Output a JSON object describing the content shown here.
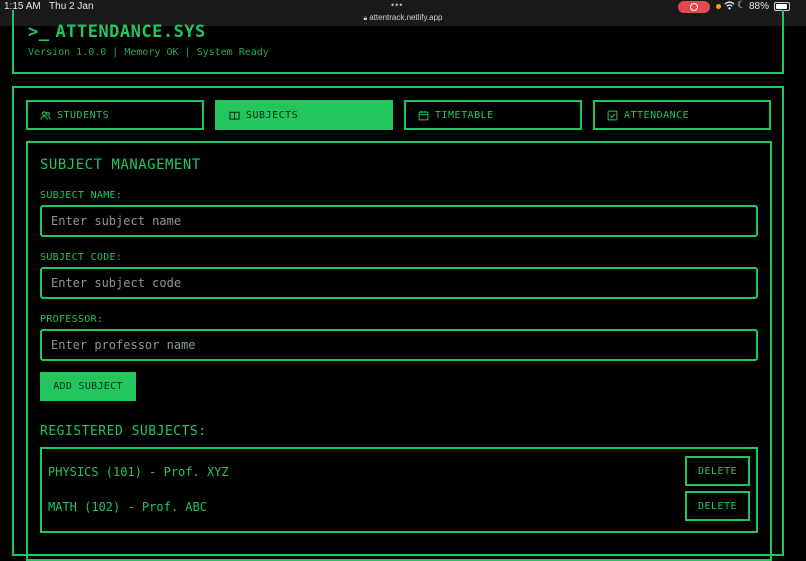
{
  "status_bar": {
    "time": "1:15 AM",
    "date": "Thu 2 Jan",
    "url": "attentrack.netlify.app",
    "battery": "88%"
  },
  "header": {
    "title": "ATTENDANCE.SYS",
    "version_line": "Version 1.0.0 | Memory OK | System Ready"
  },
  "tabs": [
    {
      "label": "STUDENTS",
      "icon": "users-icon"
    },
    {
      "label": "SUBJECTS",
      "icon": "book-icon",
      "active": true
    },
    {
      "label": "TIMETABLE",
      "icon": "calendar-icon"
    },
    {
      "label": "ATTENDANCE",
      "icon": "check-square-icon"
    }
  ],
  "subject_management": {
    "title": "SUBJECT MANAGEMENT",
    "fields": [
      {
        "label": "SUBJECT NAME:",
        "placeholder": "Enter subject name",
        "value": ""
      },
      {
        "label": "SUBJECT CODE:",
        "placeholder": "Enter subject code",
        "value": ""
      },
      {
        "label": "PROFESSOR:",
        "placeholder": "Enter professor name",
        "value": ""
      }
    ],
    "add_button": "ADD SUBJECT",
    "registered_title": "REGISTERED SUBJECTS:",
    "subjects": [
      {
        "text": "PHYSICS (101) - Prof. XYZ",
        "delete_label": "DELETE"
      },
      {
        "text": "MATH (102) - Prof. ABC",
        "delete_label": "DELETE"
      }
    ]
  },
  "colors": {
    "accent": "#22c55e",
    "background": "#000000",
    "placeholder": "#8a9a8e"
  }
}
